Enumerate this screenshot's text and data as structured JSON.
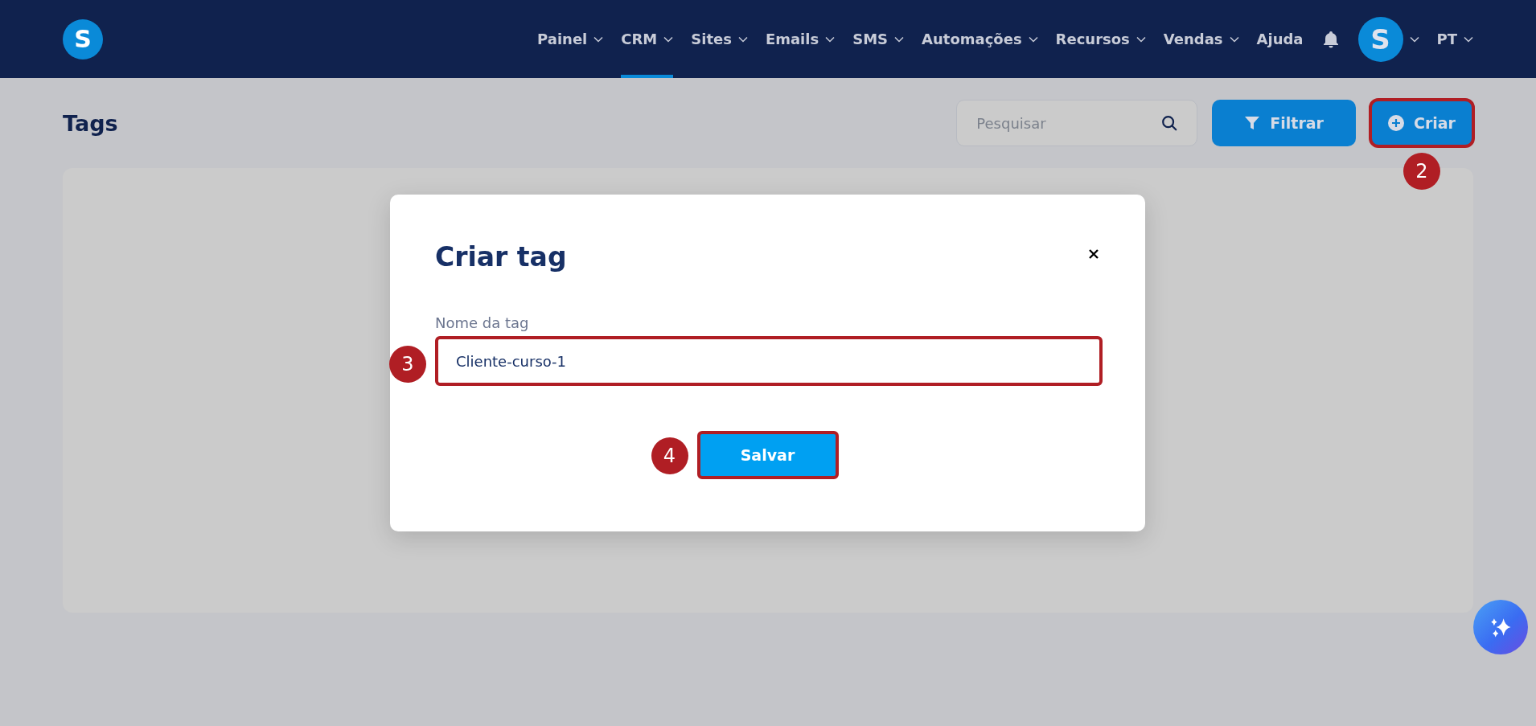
{
  "logo": {
    "letter": "S"
  },
  "nav": {
    "items": [
      {
        "label": "Painel",
        "selected": false,
        "dropdown": true
      },
      {
        "label": "CRM",
        "selected": true,
        "dropdown": true
      },
      {
        "label": "Sites",
        "selected": false,
        "dropdown": true
      },
      {
        "label": "Emails",
        "selected": false,
        "dropdown": true
      },
      {
        "label": "SMS",
        "selected": false,
        "dropdown": true
      },
      {
        "label": "Automações",
        "selected": false,
        "dropdown": true
      },
      {
        "label": "Recursos",
        "selected": false,
        "dropdown": true
      },
      {
        "label": "Vendas",
        "selected": false,
        "dropdown": true
      },
      {
        "label": "Ajuda",
        "selected": false,
        "dropdown": false
      }
    ],
    "avatar": {
      "letter": "S"
    },
    "language": "PT"
  },
  "page": {
    "title": "Tags",
    "search": {
      "placeholder": "Pesquisar"
    },
    "filter_button": "Filtrar",
    "create_button": {
      "label": "Criar",
      "highlighted": true,
      "step": "2"
    }
  },
  "modal": {
    "title": "Criar tag",
    "field": {
      "label": "Nome da tag",
      "value": "Cliente-curso-1",
      "highlighted": true,
      "step": "3"
    },
    "save_button": {
      "label": "Salvar",
      "highlighted": true,
      "step": "4"
    }
  }
}
